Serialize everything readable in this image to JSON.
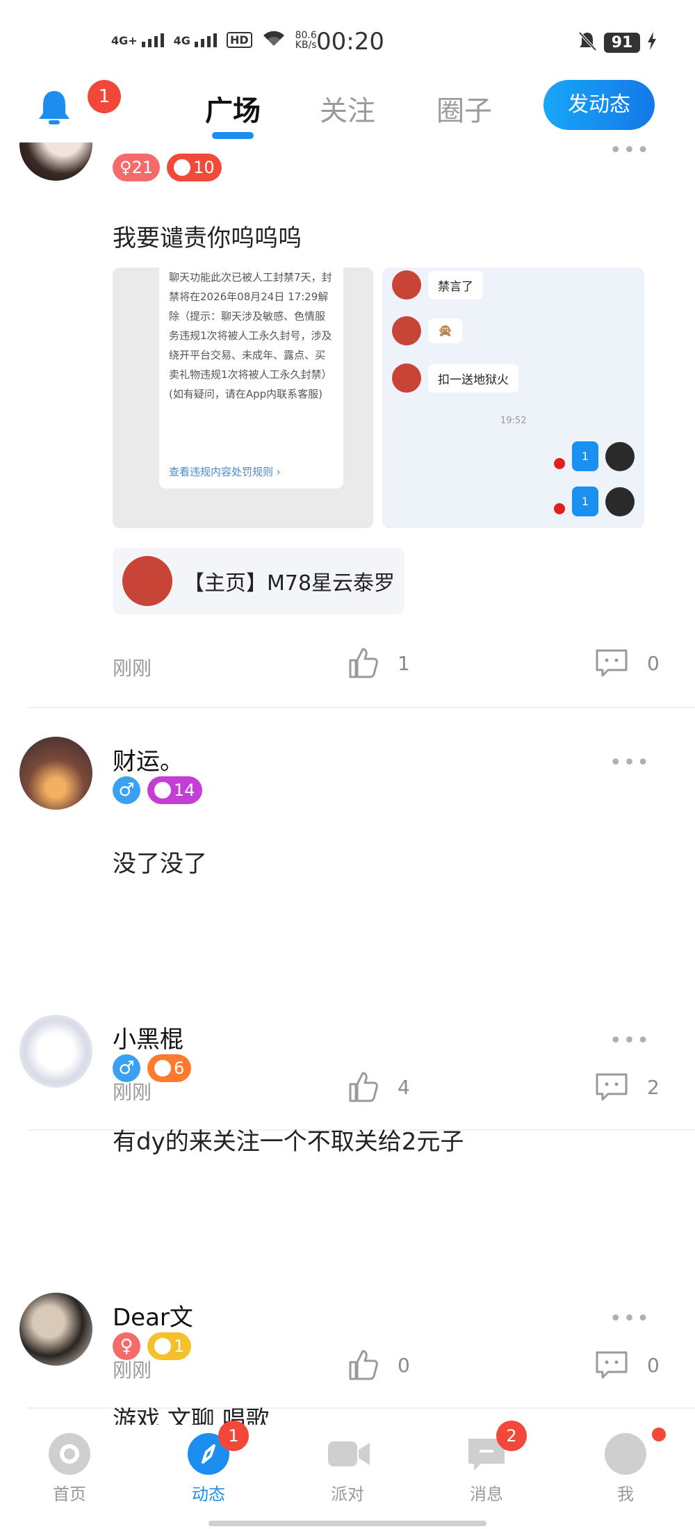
{
  "status_bar": {
    "signal1": "4G+",
    "signal2": "4G",
    "hd": "HD",
    "net_speed": "80.6",
    "net_unit": "KB/s",
    "time": "00:20",
    "battery": "91"
  },
  "topnav": {
    "bell_badge": "1",
    "tabs": [
      {
        "label": "广场",
        "active": true
      },
      {
        "label": "关注",
        "active": false
      },
      {
        "label": "圈子",
        "active": false
      }
    ],
    "post_button": "发动态"
  },
  "posts": [
    {
      "username": "",
      "badge_gender": "♀21",
      "badge_level": "10",
      "content": "我要谴责你呜呜呜",
      "image_left": {
        "notice_text": "聊天功能此次已被人工封禁7天，封禁将在2026年08月24日 17:29解除（提示：聊天涉及敏感、色情服务违规1次将被人工永久封号，涉及绕开平台交易、未成年、露点、买卖礼物违规1次将被人工永久封禁）(如有疑问，请在App内联系客服)",
        "notice_link": "查看违规内容处罚规则"
      },
      "image_right": {
        "messages": [
          "禁言了",
          "🙊",
          "扣一送地狱火"
        ],
        "chat_time": "19:52",
        "self_messages": [
          "1",
          "1"
        ]
      },
      "profile_card": "【主页】M78星云泰罗",
      "time": "刚刚",
      "likes": "1",
      "comments": "0"
    },
    {
      "username": "财运。",
      "badge_gender": "♂",
      "badge_level": "14",
      "content": "没了没了",
      "time": "刚刚",
      "likes": "4",
      "comments": "2"
    },
    {
      "username": "小黑棍",
      "badge_gender": "♂",
      "badge_level": "6",
      "content": "有dy的来关注一个不取关给2元子",
      "time": "刚刚",
      "likes": "0",
      "comments": "0"
    },
    {
      "username": "Dear文",
      "badge_gender": "♀",
      "badge_level": "1",
      "content": "游戏 文聊 唱歌"
    }
  ],
  "bottom_nav": [
    {
      "label": "首页",
      "icon": "home-icon"
    },
    {
      "label": "动态",
      "icon": "compass-icon",
      "badge": "1",
      "active": true
    },
    {
      "label": "派对",
      "icon": "video-icon"
    },
    {
      "label": "消息",
      "icon": "message-icon",
      "badge": "2"
    },
    {
      "label": "我",
      "icon": "profile-icon"
    }
  ],
  "colors": {
    "accent": "#1c8ef0",
    "badge_red": "#f2483a",
    "female": "#f36b6b",
    "male": "#3aa0f0",
    "level_red": "#f04a3a",
    "level_purple": "#c43ed6",
    "level_orange": "#ff7a2e",
    "level_yellow": "#f5c02a"
  }
}
